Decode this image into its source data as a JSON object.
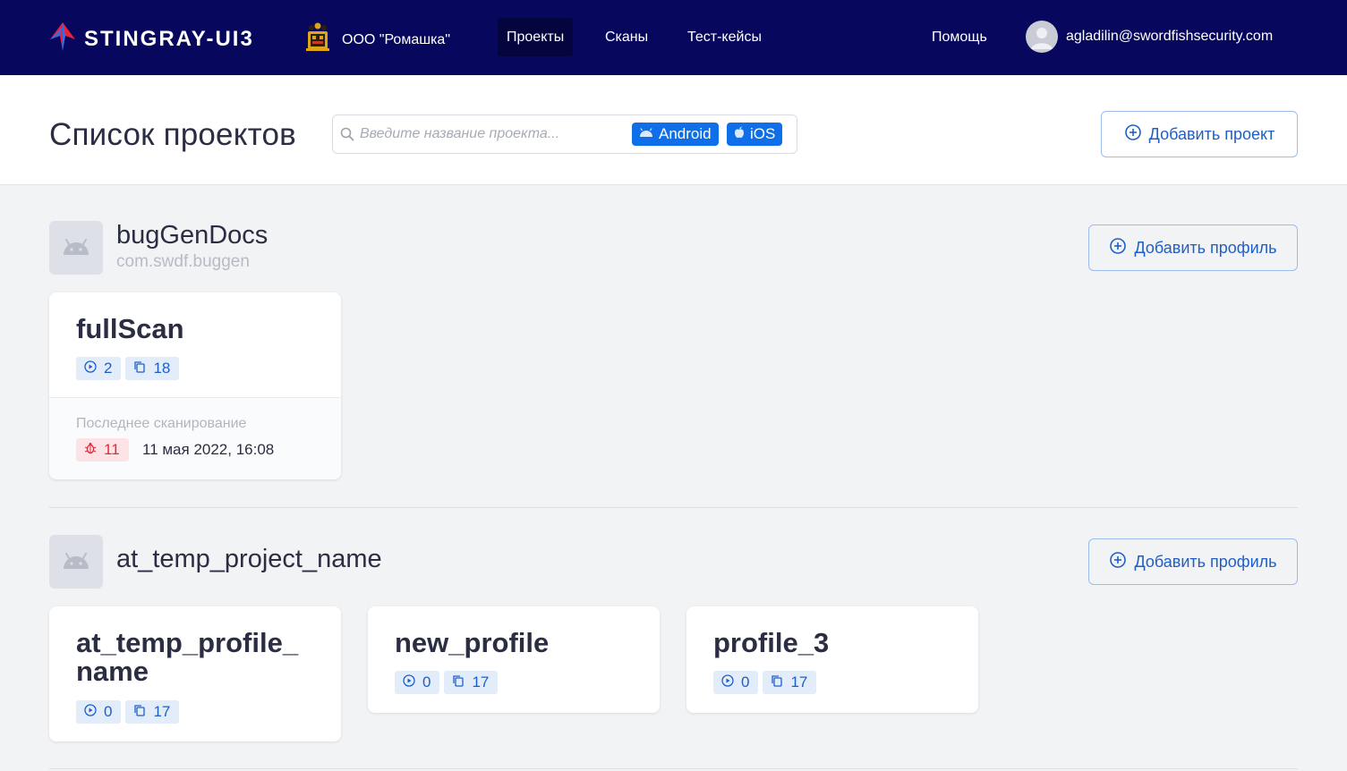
{
  "topbar": {
    "brand": "STINGRAY-UI3",
    "org_name": "ООО \"Ромашка\"",
    "nav": [
      {
        "label": "Проекты",
        "active": true
      },
      {
        "label": "Сканы",
        "active": false
      },
      {
        "label": "Тест-кейсы",
        "active": false
      }
    ],
    "help_label": "Помощь",
    "user_email": "agladilin@swordfishsecurity.com",
    "colors": {
      "background": "#06075d",
      "accent": "#e8223a"
    }
  },
  "header": {
    "title": "Список проектов",
    "search_placeholder": "Введите название проекта...",
    "filters": [
      {
        "label": "Android",
        "icon": "android-icon"
      },
      {
        "label": "iOS",
        "icon": "apple-icon"
      }
    ],
    "add_project_label": "Добавить проект"
  },
  "projects": [
    {
      "name": "bugGenDocs",
      "package": "com.swdf.buggen",
      "platform_icon": "android-icon",
      "add_profile_label": "Добавить профиль",
      "profiles": [
        {
          "name": "fullScan",
          "scans": "2",
          "testcases": "18",
          "last_scan_label": "Последнее сканирование",
          "bugs": "11",
          "last_scan_date": "11 мая 2022, 16:08"
        }
      ]
    },
    {
      "name": "at_temp_project_name",
      "package": "",
      "platform_icon": "android-icon",
      "add_profile_label": "Добавить профиль",
      "profiles": [
        {
          "name_line1": "at_temp_profile_",
          "name_line2": "name",
          "scans": "0",
          "testcases": "17"
        },
        {
          "name": "new_profile",
          "scans": "0",
          "testcases": "17"
        },
        {
          "name": "profile_3",
          "scans": "0",
          "testcases": "17"
        }
      ]
    }
  ]
}
